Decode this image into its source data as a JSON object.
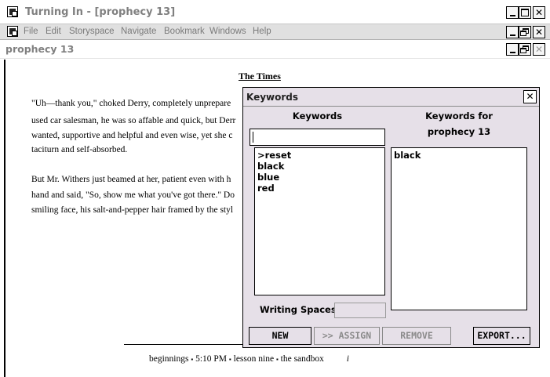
{
  "window": {
    "title": "Turning In - [prophecy 13]",
    "controls": {
      "minimize": "",
      "maximize": "",
      "close": "✕"
    }
  },
  "menu": {
    "items": [
      "File",
      "Edit",
      "Storyspace",
      "Navigate",
      "Bookmark",
      "Windows",
      "Help"
    ],
    "controls": {
      "minimize": "",
      "restore": "",
      "close": "✕"
    }
  },
  "document": {
    "window_title": "prophecy 13",
    "controls": {
      "minimize": "",
      "restore": "",
      "close": "✕"
    },
    "heading": "The Times",
    "paragraph1": [
      "\"Uh—thank you,\" choked Derry, completely unprepare",
      "used car salesman, he was so affable and quick, but Derr",
      "wanted, supportive and helpful and even wise, yet she c",
      "taciturn and self-absorbed."
    ],
    "paragraph2": [
      "But Mr. Withers just beamed at her, patient even with h",
      "hand and said, \"So, show me what you've got there.\"  Do",
      "smiling face, his salt-and-pepper hair framed by the styl"
    ],
    "footer": {
      "path": [
        "beginnings",
        "5:10 PM",
        "lesson nine",
        "the sandbox"
      ],
      "separator": "▪",
      "marker": "i"
    }
  },
  "dialog": {
    "title": "Keywords",
    "close": "✕",
    "keywords_header": "Keywords",
    "keywords_for_header_line1": "Keywords for",
    "keywords_for_header_line2": "prophecy 13",
    "search_value": "",
    "keywords_list": [
      ">reset",
      "black",
      "blue",
      "red"
    ],
    "assigned_list": [
      "black"
    ],
    "writing_spaces_label": "Writing Spaces:",
    "writing_spaces_value": "",
    "buttons": {
      "new": "NEW",
      "assign": ">> ASSIGN",
      "remove": "REMOVE",
      "export": "EXPORT..."
    },
    "button_states": {
      "new": "enabled",
      "assign": "disabled",
      "remove": "disabled",
      "export": "enabled"
    }
  },
  "colors": {
    "dialog_background": "#e6e0e8",
    "menubar_background": "#e0e0e0",
    "inactive_text": "#808080"
  }
}
